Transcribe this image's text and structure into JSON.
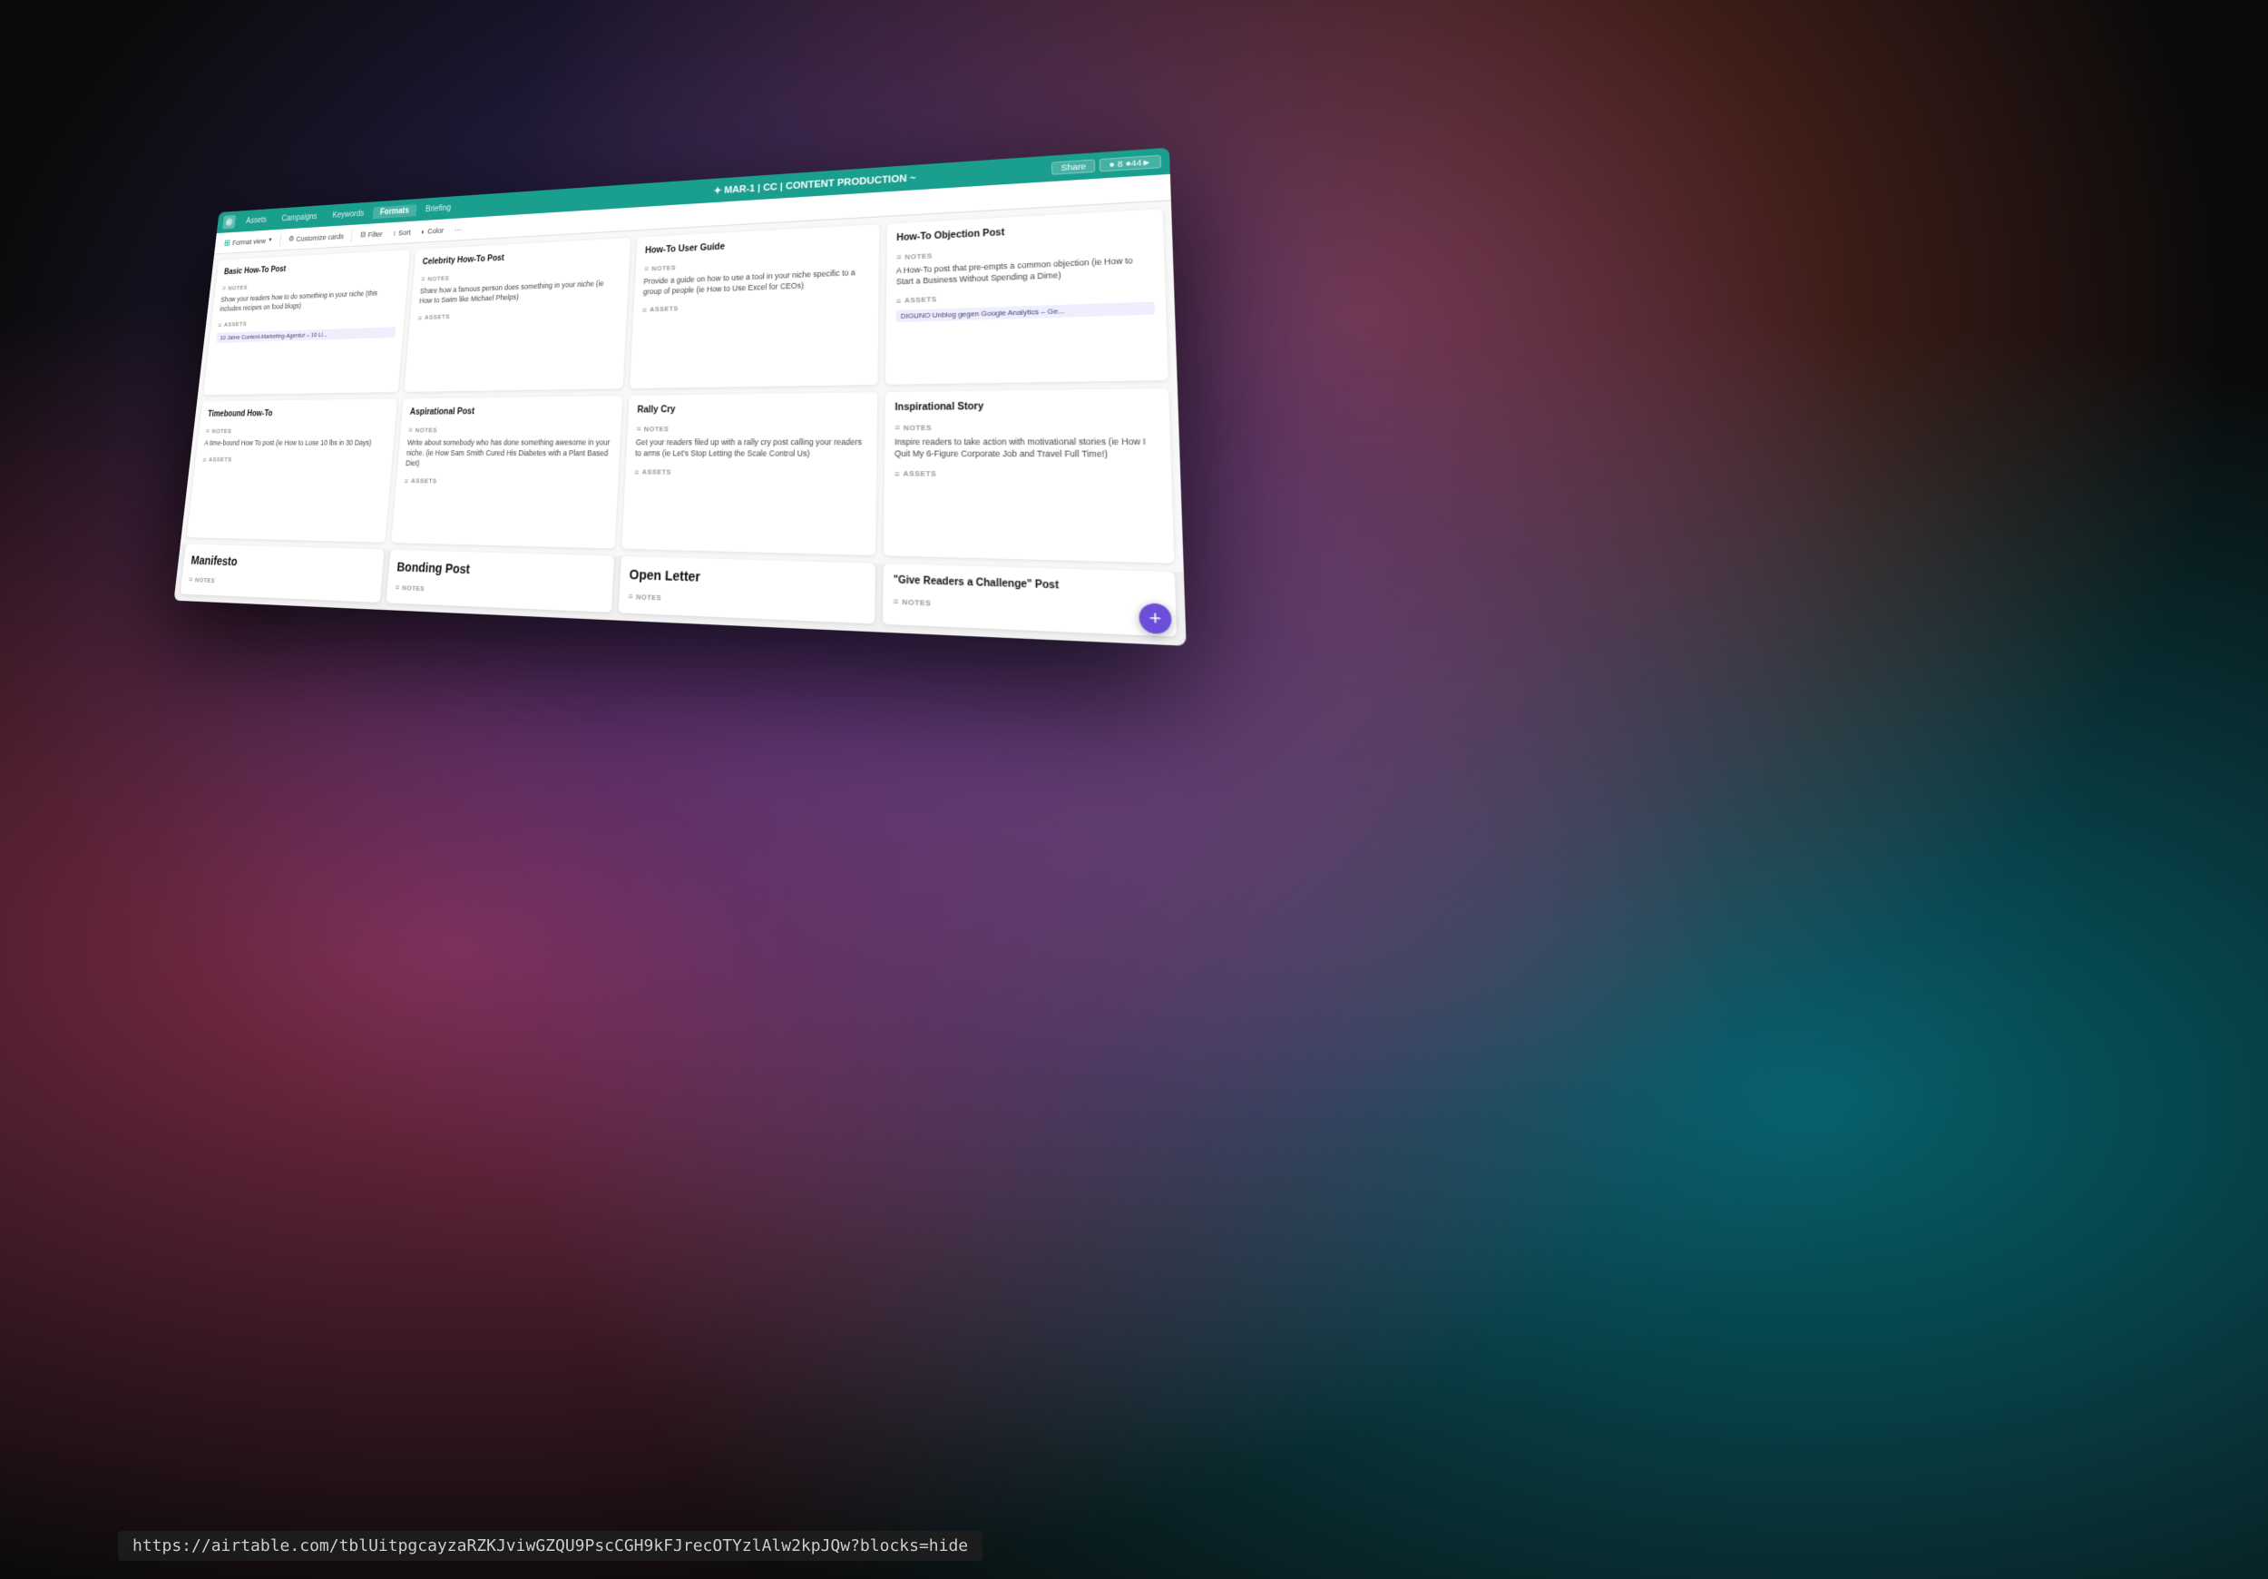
{
  "bg": {
    "colors": [
      "#1a1a2e",
      "#16213e"
    ]
  },
  "topbar": {
    "tabs": [
      {
        "label": "Assets",
        "active": false
      },
      {
        "label": "Campaigns",
        "active": false
      },
      {
        "label": "Keywords",
        "active": false
      },
      {
        "label": "Formats",
        "active": true
      },
      {
        "label": "Briefing",
        "active": false
      }
    ],
    "title": "✦ MAR-1 | CC | CONTENT PRODUCTION ~",
    "btn1": "Share",
    "btn2": "● 8 ●44►"
  },
  "toolbar2": {
    "view_icon": "⊞",
    "view_label": "Format view",
    "customize_label": "Customize cards",
    "filter_label": "Filter",
    "sort_label": "Sort",
    "color_label": "Color"
  },
  "cards": [
    {
      "id": "basic-how-to",
      "title": "Basic How-To Post",
      "notes_label": "NOTES",
      "notes_text": "Show your readers how to do something in your niche (this includes recipes on food blogs)",
      "assets_label": "ASSETS",
      "asset_chip": "10 Jahre Content-Marketing-Agentur – 10 Li..."
    },
    {
      "id": "celebrity-how-to",
      "title": "Celebrity How-To Post",
      "notes_label": "NOTES",
      "notes_text": "Share how a famous person does something in your niche (ie How to Swim like Michael Phelps)",
      "assets_label": "ASSETS",
      "asset_chip": ""
    },
    {
      "id": "how-to-user-guide",
      "title": "How-To User Guide",
      "notes_label": "NOTES",
      "notes_text": "Provide a guide on how to use a tool in your niche specific to a group of people (ie How to Use Excel for CEOs)",
      "assets_label": "ASSETS",
      "asset_chip": ""
    },
    {
      "id": "how-to-objection",
      "title": "How-To Objection Post",
      "notes_label": "NOTES",
      "notes_text": "A How-To post that pre-empts a common objection (ie How to Start a Business Without Spending a Dime)",
      "assets_label": "ASSETS",
      "asset_chip": "DIGUNO Unblog gegen Google Analytics – Ge..."
    },
    {
      "id": "timebound-how-to",
      "title": "Timebound How-To",
      "notes_label": "NOTES",
      "notes_text": "A time-bound How To post (ie How to Lose 10 lbs in 30 Days)",
      "assets_label": "ASSETS",
      "asset_chip": ""
    },
    {
      "id": "aspirational-post",
      "title": "Aspirational Post",
      "notes_label": "NOTES",
      "notes_text": "Write about somebody who has done something awesome in your niche. (ie How Sam Smith Cured His Diabetes with a Plant Based Diet)",
      "assets_label": "ASSETS",
      "asset_chip": ""
    },
    {
      "id": "rally-cry",
      "title": "Rally Cry",
      "notes_label": "NOTES",
      "notes_text": "Get your readers filed up with a rally cry post calling your readers to arms (ie Let's Stop Letting the Scale Control Us)",
      "assets_label": "ASSETS",
      "asset_chip": ""
    },
    {
      "id": "inspirational-story",
      "title": "Inspirational Story",
      "notes_label": "NOTES",
      "notes_text": "Inspire readers to take action with motivational stories (ie How I Quit My 6-Figure Corporate Job and Travel Full Time!)",
      "assets_label": "ASSETS",
      "asset_chip": ""
    },
    {
      "id": "manifesto",
      "title": "Manifesto",
      "notes_label": "NOTES",
      "notes_text": ""
    },
    {
      "id": "bonding-post",
      "title": "Bonding Post",
      "notes_label": "NOTES",
      "notes_text": ""
    },
    {
      "id": "open-letter",
      "title": "Open Letter",
      "notes_label": "NOTES",
      "notes_text": ""
    },
    {
      "id": "give-readers-challenge",
      "title": "\"Give Readers a Challenge\" Post",
      "notes_label": "NOTES",
      "notes_text": ""
    }
  ],
  "fab": {
    "label": "+"
  },
  "url": {
    "text": "https://airtable.com/tblUitpgcayzaRZKJviwGZQU9PscCGH9kFJrecOTYzlAlw2kpJQw?blocks=hide"
  }
}
